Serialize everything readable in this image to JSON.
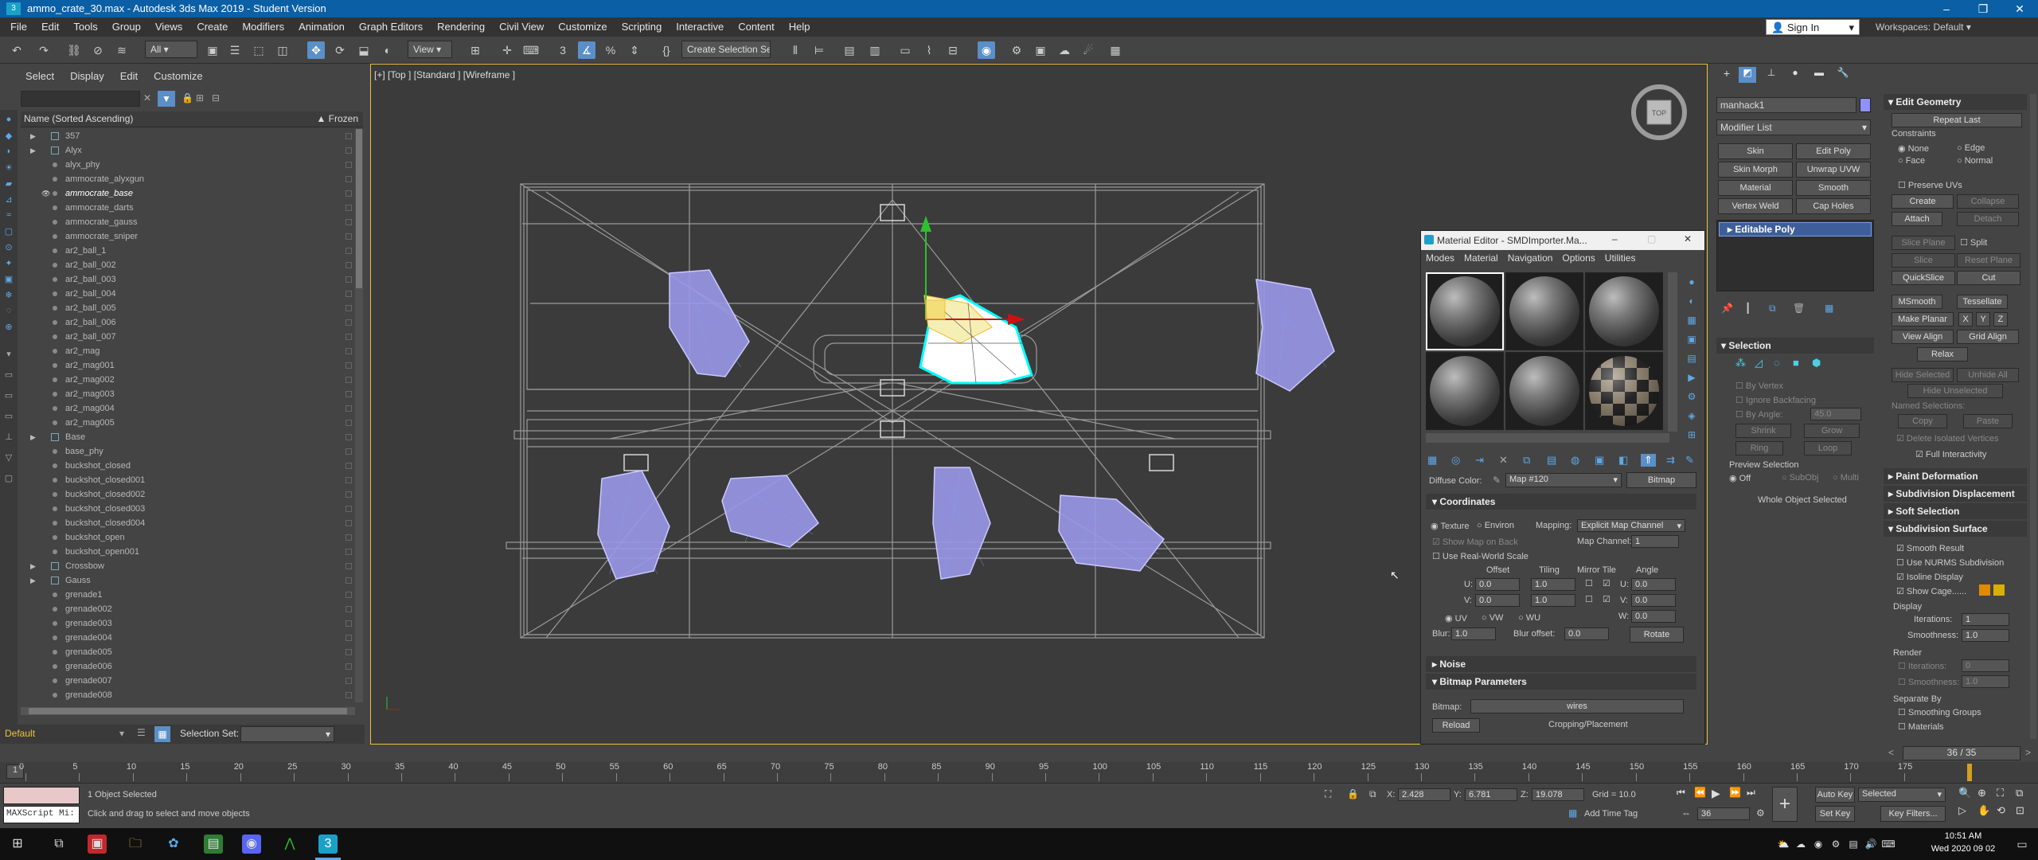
{
  "window": {
    "title": "ammo_crate_30.max - Autodesk 3ds Max 2019 - Student Version"
  },
  "menu": [
    "File",
    "Edit",
    "Tools",
    "Group",
    "Views",
    "Create",
    "Modifiers",
    "Animation",
    "Graph Editors",
    "Rendering",
    "Civil View",
    "Customize",
    "Scripting",
    "Interactive",
    "Content",
    "Help"
  ],
  "account": {
    "signin": "Sign In",
    "workspaces_label": "Workspaces:",
    "workspaces_value": "Default"
  },
  "toolbar": {
    "filter": "All",
    "refcoord": "View",
    "selset": "Create Selection Se"
  },
  "scene_explorer": {
    "tabs": [
      "Select",
      "Display",
      "Edit",
      "Customize"
    ],
    "column_name": "Name (Sorted Ascending)",
    "column_frozen": "▲ Frozen",
    "rows": [
      {
        "name": "357",
        "group": true
      },
      {
        "name": "Alyx",
        "group": true
      },
      {
        "name": "alyx_phy",
        "group": false
      },
      {
        "name": "ammocrate_alyxgun",
        "group": false
      },
      {
        "name": "ammocrate_base",
        "group": false,
        "selected": true
      },
      {
        "name": "ammocrate_darts",
        "group": false
      },
      {
        "name": "ammocrate_gauss",
        "group": false
      },
      {
        "name": "ammocrate_sniper",
        "group": false
      },
      {
        "name": "ar2_ball_1",
        "group": false
      },
      {
        "name": "ar2_ball_002",
        "group": false
      },
      {
        "name": "ar2_ball_003",
        "group": false
      },
      {
        "name": "ar2_ball_004",
        "group": false
      },
      {
        "name": "ar2_ball_005",
        "group": false
      },
      {
        "name": "ar2_ball_006",
        "group": false
      },
      {
        "name": "ar2_ball_007",
        "group": false
      },
      {
        "name": "ar2_mag",
        "group": false
      },
      {
        "name": "ar2_mag001",
        "group": false
      },
      {
        "name": "ar2_mag002",
        "group": false
      },
      {
        "name": "ar2_mag003",
        "group": false
      },
      {
        "name": "ar2_mag004",
        "group": false
      },
      {
        "name": "ar2_mag005",
        "group": false
      },
      {
        "name": "Base",
        "group": true
      },
      {
        "name": "base_phy",
        "group": false
      },
      {
        "name": "buckshot_closed",
        "group": false
      },
      {
        "name": "buckshot_closed001",
        "group": false
      },
      {
        "name": "buckshot_closed002",
        "group": false
      },
      {
        "name": "buckshot_closed003",
        "group": false
      },
      {
        "name": "buckshot_closed004",
        "group": false
      },
      {
        "name": "buckshot_open",
        "group": false
      },
      {
        "name": "buckshot_open001",
        "group": false
      },
      {
        "name": "Crossbow",
        "group": true
      },
      {
        "name": "Gauss",
        "group": true
      },
      {
        "name": "grenade1",
        "group": false
      },
      {
        "name": "grenade002",
        "group": false
      },
      {
        "name": "grenade003",
        "group": false
      },
      {
        "name": "grenade004",
        "group": false
      },
      {
        "name": "grenade005",
        "group": false
      },
      {
        "name": "grenade006",
        "group": false
      },
      {
        "name": "grenade007",
        "group": false
      },
      {
        "name": "grenade008",
        "group": false
      }
    ],
    "layer": "Default",
    "selection_set_label": "Selection Set:"
  },
  "viewport": {
    "label": "[+] [Top ] [Standard ] [Wireframe ]"
  },
  "material_editor": {
    "title": "Material Editor - SMDImporter.Ma...",
    "menu": [
      "Modes",
      "Material",
      "Navigation",
      "Options",
      "Utilities"
    ],
    "diffuse_label": "Diffuse Color:",
    "map_name": "Map #120",
    "map_type": "Bitmap",
    "coordinates": {
      "title": "Coordinates",
      "texture": "Texture",
      "environ": "Environ",
      "mapping_label": "Mapping:",
      "mapping_value": "Explicit Map Channel",
      "show_map_on_back": "Show Map on Back",
      "map_channel_label": "Map Channel:",
      "map_channel_value": "1",
      "real_world": "Use Real-World Scale",
      "offset": "Offset",
      "tiling": "Tiling",
      "mirror_tile": "Mirror Tile",
      "angle": "Angle",
      "u_label": "U:",
      "v_label": "V:",
      "w_label": "W:",
      "u_offset": "0.0",
      "v_offset": "0.0",
      "u_tiling": "1.0",
      "v_tiling": "1.0",
      "u_angle": "0.0",
      "v_angle": "0.0",
      "w_angle": "0.0",
      "uv": "UV",
      "vw": "VW",
      "wu": "WU",
      "blur_label": "Blur:",
      "blur": "1.0",
      "blur_offset_label": "Blur offset:",
      "blur_offset": "0.0",
      "rotate": "Rotate"
    },
    "noise": "Noise",
    "bitmap_params": "Bitmap Parameters",
    "bitmap_label": "Bitmap:",
    "bitmap_value": "wires",
    "reload": "Reload",
    "cropping": "Cropping/Placement"
  },
  "command_panel": {
    "object_name": "manhack1",
    "modifier_list": "Modifier List",
    "mod_buttons": [
      "Skin",
      "Edit Poly",
      "Skin Morph",
      "Unwrap UVW",
      "Material",
      "Smooth",
      "Vertex Weld",
      "Cap Holes"
    ],
    "stack_item": "Editable Poly",
    "selection": {
      "title": "Selection",
      "by_vertex": "By Vertex",
      "ignore_backfacing": "Ignore Backfacing",
      "by_angle": "By Angle:",
      "by_angle_value": "45.0",
      "shrink": "Shrink",
      "grow": "Grow",
      "ring": "Ring",
      "loop": "Loop",
      "preview_label": "Preview Selection",
      "off": "Off",
      "subobj": "SubObj",
      "multi": "Multi",
      "status": "Whole Object Selected"
    },
    "edit_geometry": {
      "title": "Edit Geometry",
      "repeat_last": "Repeat Last",
      "constraints": "Constraints",
      "none": "None",
      "edge": "Edge",
      "face": "Face",
      "normal": "Normal",
      "preserve_uvs": "Preserve UVs",
      "create": "Create",
      "collapse": "Collapse",
      "attach": "Attach",
      "detach": "Detach",
      "slice_plane": "Slice Plane",
      "split": "Split",
      "slice": "Slice",
      "reset_plane": "Reset Plane",
      "quickslice": "QuickSlice",
      "cut": "Cut",
      "msmooth": "MSmooth",
      "tessellate": "Tessellate",
      "make_planar": "Make Planar",
      "x": "X",
      "y": "Y",
      "z": "Z",
      "view_align": "View Align",
      "grid_align": "Grid Align",
      "relax": "Relax",
      "hide_selected": "Hide Selected",
      "unhide_all": "Unhide All",
      "hide_unselected": "Hide Unselected",
      "named_selections": "Named Selections:",
      "copy": "Copy",
      "paste": "Paste",
      "delete_isolated": "Delete Isolated Vertices",
      "full_interactivity": "Full Interactivity"
    },
    "paint_deformation": "Paint Deformation",
    "subdivision_displacement": "Subdivision Displacement",
    "soft_selection": "Soft Selection",
    "subdivision_surface": {
      "title": "Subdivision Surface",
      "smooth_result": "Smooth Result",
      "nurms": "Use NURMS Subdivision",
      "isoline": "Isoline Display",
      "show_cage": "Show Cage......",
      "display": "Display",
      "iterations_label": "Iterations:",
      "iterations": "1",
      "smoothness_label": "Smoothness:",
      "smoothness": "1.0",
      "render": "Render",
      "r_iterations": "0",
      "r_smoothness": "1.0",
      "separate_by": "Separate By",
      "smoothing_groups": "Smoothing Groups",
      "materials": "Materials"
    },
    "colors": {
      "cage1": "#e08a00",
      "cage2": "#d8b000"
    }
  },
  "timeline": {
    "frame_slider": "36 / 35",
    "ticks": [
      "0",
      "5",
      "10",
      "15",
      "20",
      "25",
      "30",
      "35",
      "40",
      "45",
      "50",
      "55",
      "60",
      "65",
      "70",
      "75",
      "80",
      "85",
      "90",
      "95",
      "100",
      "105",
      "110",
      "115",
      "120",
      "125",
      "130",
      "135",
      "140",
      "145",
      "150",
      "155",
      "160",
      "165",
      "170",
      "175"
    ],
    "first_tick": "1"
  },
  "status": {
    "objects_selected": "1 Object Selected",
    "prompt": "Click and drag to select and move objects",
    "maxscript": "MAXScript Mi:",
    "x_label": "X:",
    "x": "2.428",
    "y_label": "Y:",
    "y": "6.781",
    "z_label": "Z:",
    "z": "19.078",
    "grid": "Grid = 10.0",
    "add_time_tag": "Add Time Tag",
    "frame": "36",
    "auto_key": "Auto Key",
    "set_key": "Set Key",
    "key_mode": "Selected",
    "key_filters": "Key Filters..."
  },
  "clock": {
    "time": "10:51 AM",
    "date": "Wed 2020 09 02"
  }
}
